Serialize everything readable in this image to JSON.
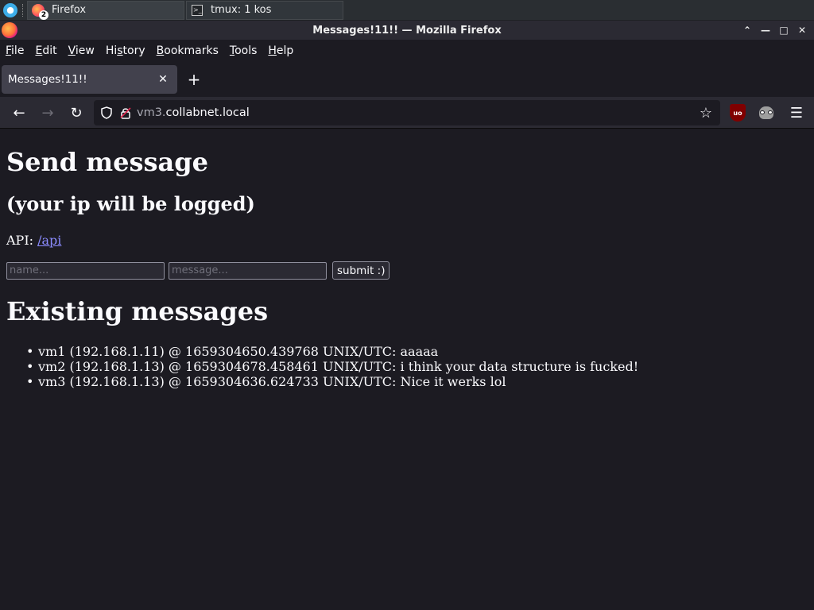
{
  "taskbar": {
    "firefox_label": "Firefox",
    "firefox_badge": "2",
    "tmux_label": "tmux: 1 kos"
  },
  "window": {
    "title": "Messages!11!! — Mozilla Firefox"
  },
  "menu": {
    "items": [
      {
        "first": "F",
        "rest": "ile"
      },
      {
        "first": "E",
        "rest": "dit"
      },
      {
        "first": "V",
        "rest": "iew"
      },
      {
        "first": "H",
        "rest": "istory",
        "underline_index": 2
      },
      {
        "first": "B",
        "rest": "ookmarks"
      },
      {
        "first": "T",
        "rest": "ools"
      },
      {
        "first": "H",
        "rest": "elp"
      }
    ]
  },
  "tab": {
    "title": "Messages!11!!",
    "close_glyph": "✕",
    "new_tab_glyph": "+"
  },
  "nav": {
    "url_prefix": "vm3.",
    "url_domain": "collabnet.local",
    "ublock_label": "uo"
  },
  "page": {
    "heading": "Send message",
    "subheading": "(your ip will be logged)",
    "api_label": "API: ",
    "api_link": "/api",
    "name_placeholder": "name...",
    "message_placeholder": "message...",
    "submit_label": "submit :)",
    "existing_heading": "Existing messages",
    "messages": [
      "vm1 (192.168.1.11) @ 1659304650.439768 UNIX/UTC: aaaaa",
      "vm2 (192.168.1.13) @ 1659304678.458461 UNIX/UTC: i think your data structure is fucked!",
      "vm3 (192.168.1.13) @ 1659304636.624733 UNIX/UTC: Nice it werks lol"
    ]
  }
}
